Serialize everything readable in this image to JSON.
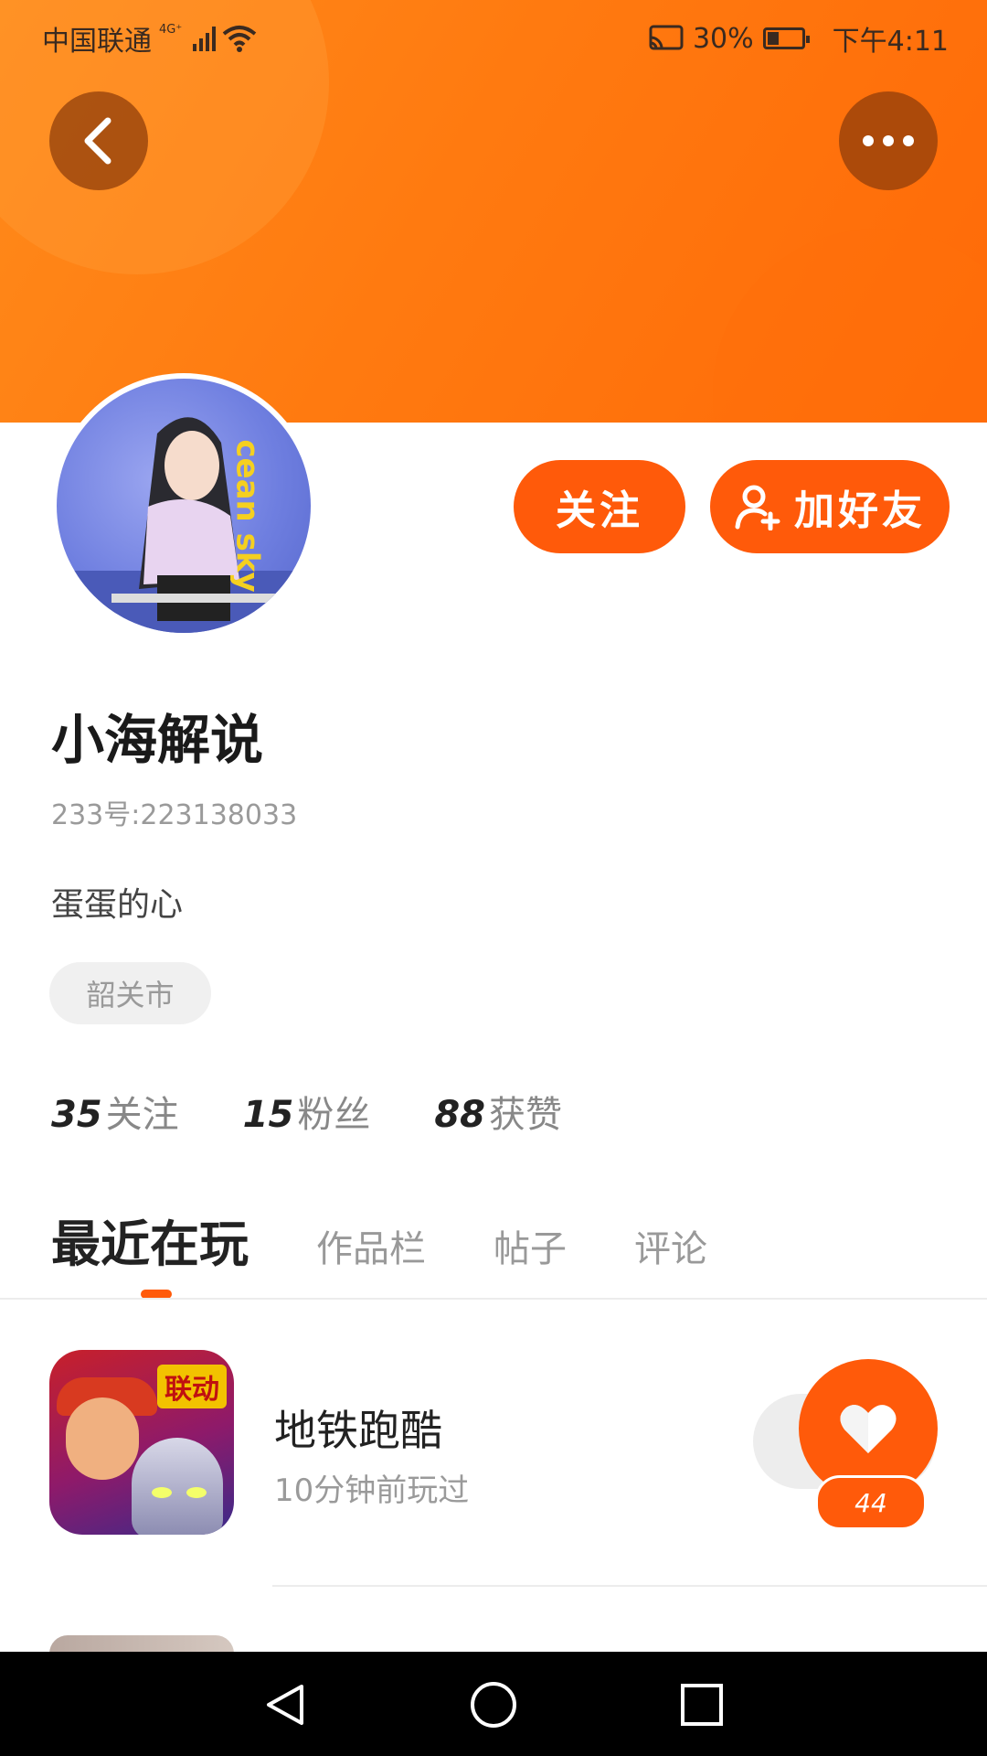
{
  "status_bar": {
    "carrier": "中国联通",
    "network": "4G⁺",
    "battery_percent": "30%",
    "time": "下午4:11"
  },
  "header": {
    "back_icon": "chevron-left-icon",
    "more_icon": "more-horizontal-icon",
    "accent_color": "#ff7a10"
  },
  "profile": {
    "avatar_text": "cean sky",
    "name": "小海解说",
    "id_label": "233号:223138033",
    "bio": "蛋蛋的心",
    "location": "韶关市"
  },
  "actions": {
    "follow_label": "关注",
    "add_friend_label": "加好友",
    "add_friend_icon": "user-plus-icon",
    "button_color": "#ff5a0a"
  },
  "stats": [
    {
      "num": "35",
      "label": "关注"
    },
    {
      "num": "15",
      "label": "粉丝"
    },
    {
      "num": "88",
      "label": "获赞"
    }
  ],
  "tabs": [
    {
      "label": "最近在玩",
      "active": true
    },
    {
      "label": "作品栏",
      "active": false
    },
    {
      "label": "帖子",
      "active": false
    },
    {
      "label": "评论",
      "active": false
    }
  ],
  "games": [
    {
      "title": "地铁跑酷",
      "subtitle": "10分钟前玩过",
      "icon_badge": "联动",
      "likes": "44",
      "like_icon": "heart-icon"
    }
  ],
  "navbar": {
    "back_icon": "triangle-back-icon",
    "home_icon": "circle-home-icon",
    "recent_icon": "square-recent-icon"
  }
}
